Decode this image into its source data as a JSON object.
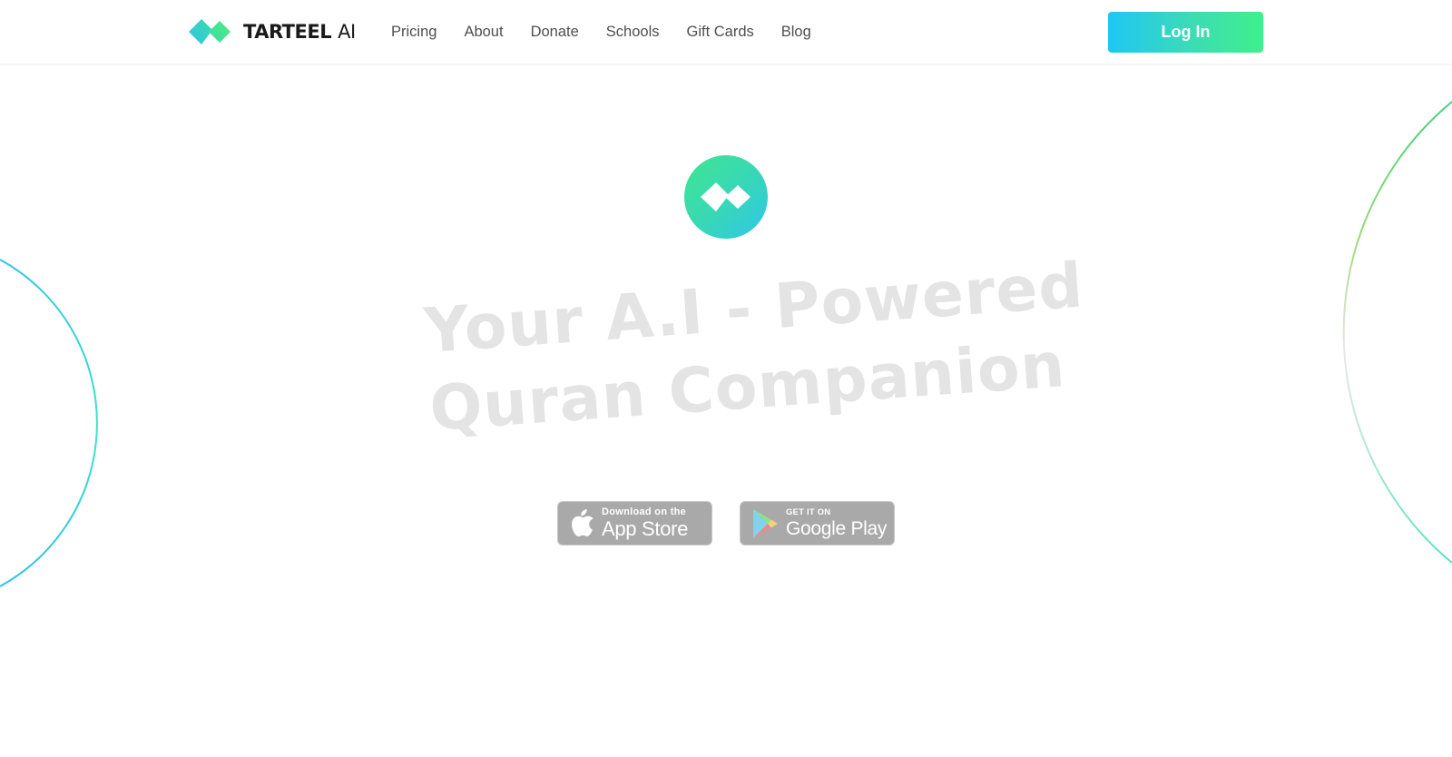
{
  "brand": {
    "name_strong": "TARTEEL",
    "name_light": "AI",
    "logo_icon": "tarteel-diamonds-icon"
  },
  "nav": {
    "items": [
      {
        "label": "Pricing"
      },
      {
        "label": "About"
      },
      {
        "label": "Donate"
      },
      {
        "label": "Schools"
      },
      {
        "label": "Gift Cards"
      },
      {
        "label": "Blog"
      }
    ]
  },
  "header": {
    "login_label": "Log In"
  },
  "hero": {
    "headline_line1": "Your A.I - Powered",
    "headline_line2": "Quran Companion",
    "mark_icon": "tarteel-mark-icon"
  },
  "stores": {
    "apple": {
      "small": "Download on the",
      "big": "App Store",
      "icon": "apple-icon"
    },
    "google": {
      "small": "GET IT ON",
      "big": "Google Play",
      "icon": "google-play-icon"
    }
  },
  "colors": {
    "brand_green": "#3ff08a",
    "brand_cyan": "#1ec7f5",
    "headline_gray": "#e4e4e4",
    "badge_gray": "#a9a9a9"
  }
}
